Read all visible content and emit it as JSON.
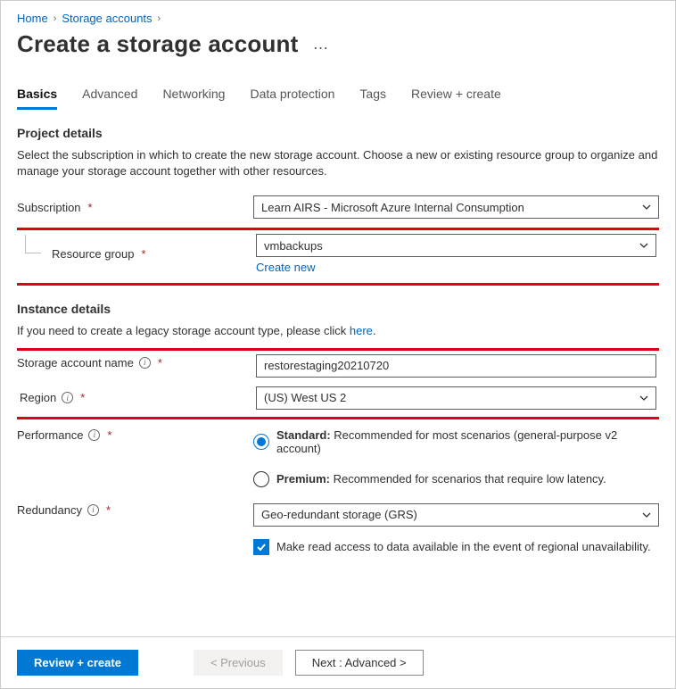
{
  "breadcrumbs": {
    "home": "Home",
    "storage_accounts": "Storage accounts"
  },
  "page_title": "Create a storage account",
  "tabs": {
    "basics": "Basics",
    "advanced": "Advanced",
    "networking": "Networking",
    "data_protection": "Data protection",
    "tags": "Tags",
    "review": "Review + create"
  },
  "project_details": {
    "heading": "Project details",
    "description": "Select the subscription in which to create the new storage account. Choose a new or existing resource group to organize and manage your storage account together with other resources.",
    "subscription_label": "Subscription",
    "subscription_value": "Learn AIRS - Microsoft Azure Internal Consumption",
    "resource_group_label": "Resource group",
    "resource_group_value": "vmbackups",
    "create_new": "Create new"
  },
  "instance_details": {
    "heading": "Instance details",
    "description_prefix": "If you need to create a legacy storage account type, please click ",
    "description_link": "here",
    "description_suffix": ".",
    "name_label": "Storage account name",
    "name_value": "restorestaging20210720",
    "region_label": "Region",
    "region_value": "(US) West US 2",
    "performance_label": "Performance",
    "performance_standard_bold": "Standard:",
    "performance_standard_rest": " Recommended for most scenarios (general-purpose v2 account)",
    "performance_premium_bold": "Premium:",
    "performance_premium_rest": " Recommended for scenarios that require low latency.",
    "redundancy_label": "Redundancy",
    "redundancy_value": "Geo-redundant storage (GRS)",
    "ra_checkbox": "Make read access to data available in the event of regional unavailability."
  },
  "footer": {
    "review": "Review + create",
    "previous": "<  Previous",
    "next": "Next : Advanced  >"
  }
}
